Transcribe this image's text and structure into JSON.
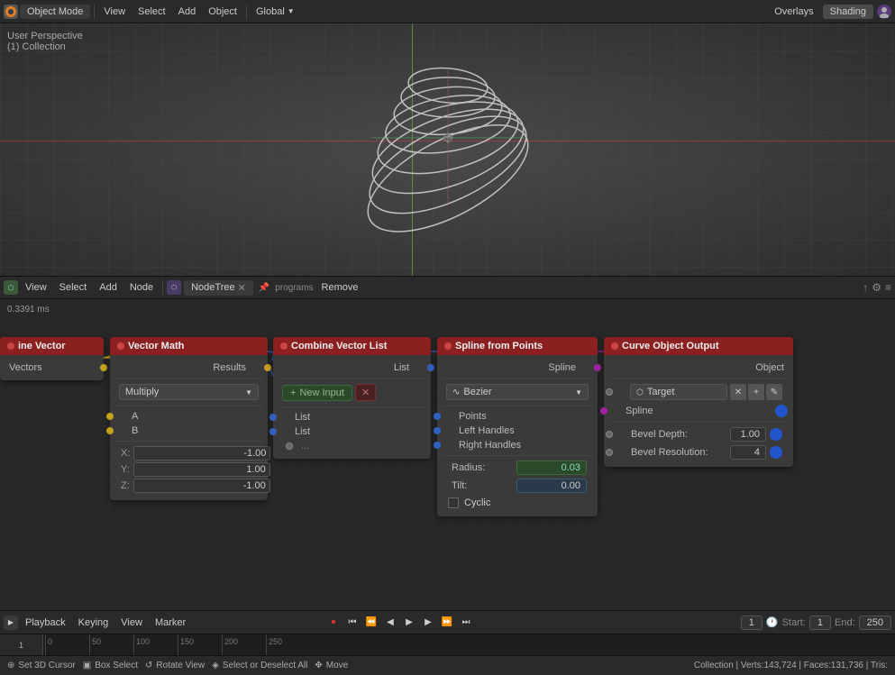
{
  "topbar": {
    "mode": "Object Mode",
    "menus": [
      "View",
      "Select",
      "Add",
      "Object"
    ],
    "transform": "Global",
    "overlays": "Overlays",
    "shading": "Shading",
    "workspace": "User Perspective",
    "collection": "(1) Collection"
  },
  "nodebar": {
    "timing": "0.3391 ms",
    "menus": [
      "View",
      "Select",
      "Add",
      "Node"
    ],
    "nodetree": "NodeTree",
    "programs": "programs",
    "remove": "Remove"
  },
  "nodes": {
    "combine_inline": {
      "title": "ine Vector",
      "outputs": [
        "Vectors"
      ]
    },
    "vector_math": {
      "title": "Vector Math",
      "inputs": [
        "A",
        "B"
      ],
      "outputs": [
        "Results"
      ],
      "operation": "Multiply",
      "x": "-1.00",
      "y": "1.00",
      "z": "-1.00"
    },
    "combine_vector_list": {
      "title": "Combine Vector List",
      "output": "List",
      "add_label": "New Input",
      "list_items": [
        "List",
        "List"
      ],
      "dots": "..."
    },
    "spline_from_points": {
      "title": "Spline from Points",
      "output": "Spline",
      "type": "Bezier",
      "rows": [
        "Points",
        "Left Handles",
        "Right Handles"
      ],
      "radius_label": "Radius:",
      "radius_val": "0.03",
      "tilt_label": "Tilt:",
      "tilt_val": "0.00",
      "cyclic_label": "Cyclic"
    },
    "curve_output": {
      "title": "Curve Object Output",
      "output": "Object",
      "target": "Target",
      "spline_label": "Spline",
      "bevel_depth_label": "Bevel Depth:",
      "bevel_depth_val": "1.00",
      "bevel_res_label": "Bevel Resolution:",
      "bevel_res_val": "4"
    }
  },
  "timeline": {
    "numbers": [
      "0",
      "50",
      "100",
      "150",
      "200",
      "250"
    ],
    "frame": "1",
    "start": "1",
    "end": "250",
    "start_label": "Start:",
    "end_label": "End:"
  },
  "statusbar": {
    "cursor_label": "Set 3D Cursor",
    "box_select": "Box Select",
    "rotate_view": "Rotate View",
    "select_all": "Select or Deselect All",
    "move": "Move",
    "collection_info": "Collection | Verts:143,724 | Faces:131,736 | Tris:"
  },
  "playback": {
    "menu": "Playback",
    "keying": "Keying",
    "view": "View",
    "marker": "Marker"
  }
}
